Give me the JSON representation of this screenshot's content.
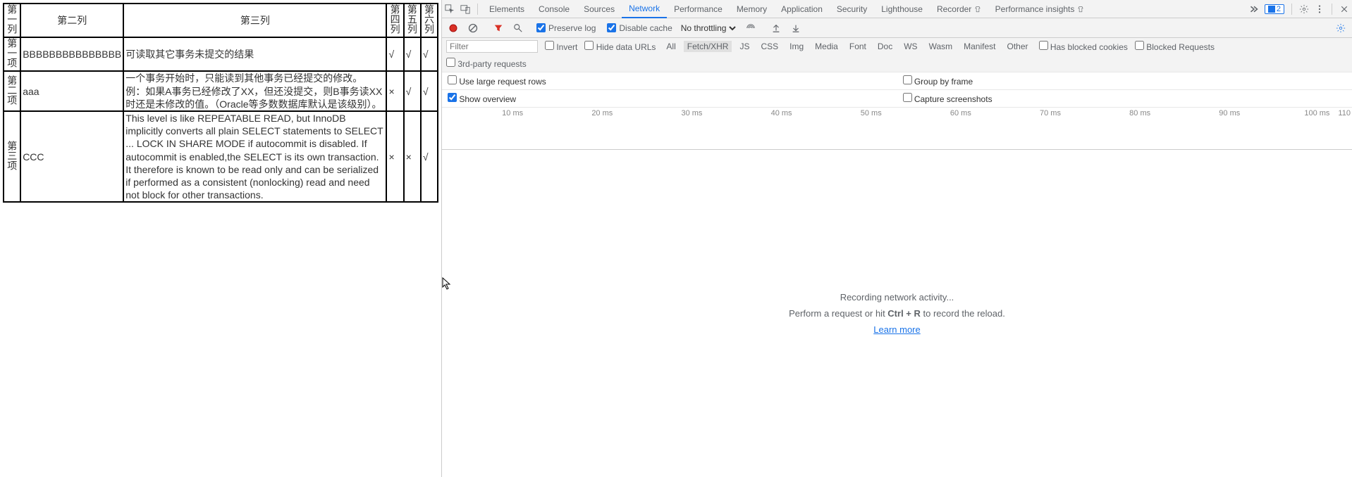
{
  "left_table": {
    "headers": [
      "第一列",
      "第二列",
      "第三列",
      "第四列",
      "第五列",
      "第六列"
    ],
    "rows": [
      {
        "c1": "第一项",
        "c2": "BBBBBBBBBBBBBBB",
        "c3": "可读取其它事务未提交的结果",
        "c4": "√",
        "c5": "√",
        "c6": "√"
      },
      {
        "c1": "第二项",
        "c2": "aaa",
        "c3": "一个事务开始时，只能读到其他事务已经提交的修改。 例：如果A事务已经修改了XX，但还没提交，则B事务读XX时还是未修改的值。（Oracle等多数数据库默认是该级别）。",
        "c4": "×",
        "c5": "√",
        "c6": "√"
      },
      {
        "c1": "第三项",
        "c2": "CCC",
        "c3": "This level is like REPEATABLE READ, but InnoDB implicitly converts all plain SELECT statements to SELECT ... LOCK IN SHARE MODE if autocommit is disabled. If autocommit is enabled,the SELECT is its own transaction. It therefore is known to be read only and can be serialized if performed as a consistent (nonlocking) read and need not block for other transactions.",
        "c4": "×",
        "c5": "×",
        "c6": "√"
      }
    ]
  },
  "devtools": {
    "tabs": [
      "Elements",
      "Console",
      "Sources",
      "Network",
      "Performance",
      "Memory",
      "Application",
      "Security",
      "Lighthouse",
      "Recorder",
      "Performance insights"
    ],
    "selected_tab": "Network",
    "badge_count": "2",
    "subbar": {
      "preserve_log": "Preserve log",
      "disable_cache": "Disable cache",
      "throttling": "No throttling"
    },
    "filter": {
      "placeholder": "Filter",
      "invert": "Invert",
      "hide_data_urls": "Hide data URLs",
      "chips": [
        "All",
        "Fetch/XHR",
        "JS",
        "CSS",
        "Img",
        "Media",
        "Font",
        "Doc",
        "WS",
        "Wasm",
        "Manifest",
        "Other"
      ],
      "selected_chip": "Fetch/XHR",
      "has_blocked_cookies": "Has blocked cookies",
      "blocked_requests": "Blocked Requests",
      "third_party": "3rd-party requests"
    },
    "options": {
      "large_rows": "Use large request rows",
      "group_by_frame": "Group by frame",
      "show_overview": "Show overview",
      "capture_screenshots": "Capture screenshots"
    },
    "overview_ticks": [
      "10 ms",
      "20 ms",
      "30 ms",
      "40 ms",
      "50 ms",
      "60 ms",
      "70 ms",
      "80 ms",
      "90 ms",
      "100 ms",
      "110"
    ],
    "empty": {
      "line1": "Recording network activity...",
      "line2a": "Perform a request or hit ",
      "line2b": "Ctrl + R",
      "line2c": " to record the reload.",
      "learn": "Learn more"
    }
  }
}
